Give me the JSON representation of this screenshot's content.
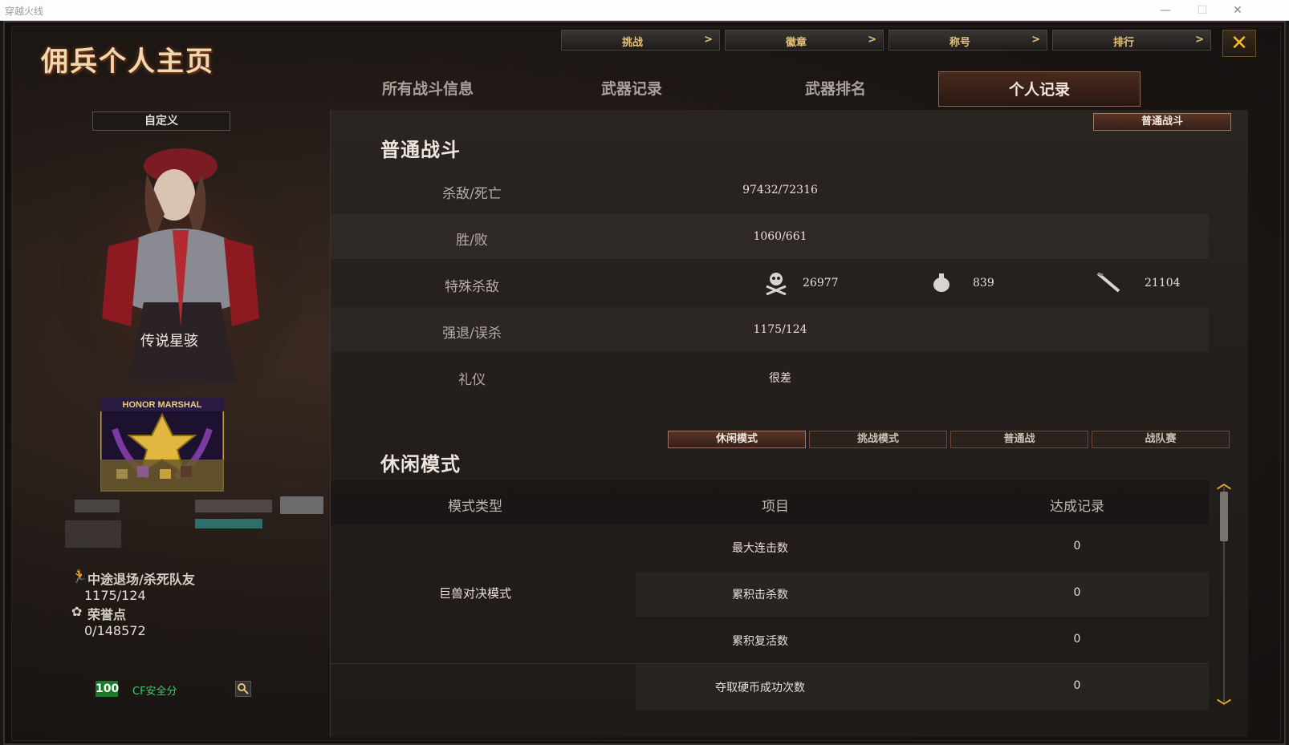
{
  "window": {
    "title": "穿越火线",
    "minimize": "—",
    "maximize": "☐",
    "close": "✕"
  },
  "page_title": "佣兵个人主页",
  "top_nav": [
    {
      "label": "挑战",
      "chevron": ">"
    },
    {
      "label": "徽章",
      "chevron": ">"
    },
    {
      "label": "称号",
      "chevron": ">"
    },
    {
      "label": "排行",
      "chevron": ">"
    }
  ],
  "close_label": "✕",
  "tabs": [
    {
      "label": "所有战斗信息"
    },
    {
      "label": "武器记录"
    },
    {
      "label": "武器排名"
    },
    {
      "label": "个人记录",
      "active": true
    }
  ],
  "sidebar": {
    "custom_label": "自定义",
    "character_name": "传说星骇",
    "badge_text": "HONOR MARSHAL",
    "quit_kill_label": "中途退场/杀死队友",
    "quit_kill_value": "1175/124",
    "honor_label": "荣誉点",
    "honor_value": "0/148572",
    "security_score": "100",
    "security_label": "CF安全分"
  },
  "normal_battle": {
    "title": "普通战斗",
    "button": "普通战斗",
    "rows": [
      {
        "label": "杀敌/死亡",
        "value": "97432/72316"
      },
      {
        "label": "胜/败",
        "value": "1060/661"
      },
      {
        "label": "特殊杀敌",
        "headshot": "26977",
        "grenade": "839",
        "knife": "21104"
      },
      {
        "label": "强退/误杀",
        "value": "1175/124"
      },
      {
        "label": "礼仪",
        "value": "很差"
      }
    ]
  },
  "casual_mode": {
    "title": "休闲模式",
    "mode_tabs": [
      {
        "label": "休闲模式",
        "active": true
      },
      {
        "label": "挑战模式"
      },
      {
        "label": "普通战"
      },
      {
        "label": "战队赛"
      }
    ],
    "headers": [
      "模式类型",
      "项目",
      "达成记录"
    ],
    "group_name": "巨兽对决模式",
    "rows": [
      {
        "item": "最大连击数",
        "record": "0"
      },
      {
        "item": "累积击杀数",
        "record": "0"
      },
      {
        "item": "累积复活数",
        "record": "0"
      },
      {
        "item": "夺取硬币成功次数",
        "record": "0"
      }
    ]
  },
  "colors": {
    "accent": "#e6c27a",
    "close": "#f5b630",
    "security": "#47c86a"
  }
}
